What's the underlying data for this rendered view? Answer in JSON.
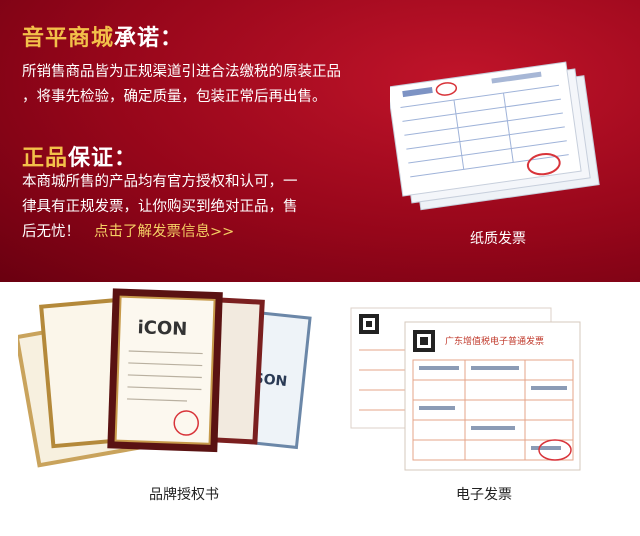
{
  "promise": {
    "title_accent": "音平商城",
    "title_rest": "承诺：",
    "line1": "所销售商品皆为正规渠道引进合法缴税的原装正品",
    "line2": "，将事先检验，确定质量，包装正常后再出售。"
  },
  "guarantee": {
    "title_accent": "正品",
    "title_rest": "保证：",
    "line1": "本商城所售的产品均有官方授权和认可，一",
    "line2": "律具有正规发票，让你购买到绝对正品，售",
    "line3": "后无忧！",
    "link": "点击了解发票信息>>"
  },
  "gallery": {
    "paper_invoice": "纸质发票",
    "brand_auth": "品牌授权书",
    "e_invoice": "电子发票"
  },
  "e_invoice_header": "广东增值税电子普通发票",
  "colors": {
    "bg_red": "#96061a",
    "accent_gold": "#f3c04a",
    "link_gold": "#f5cf65",
    "text_white": "#ffffff"
  }
}
